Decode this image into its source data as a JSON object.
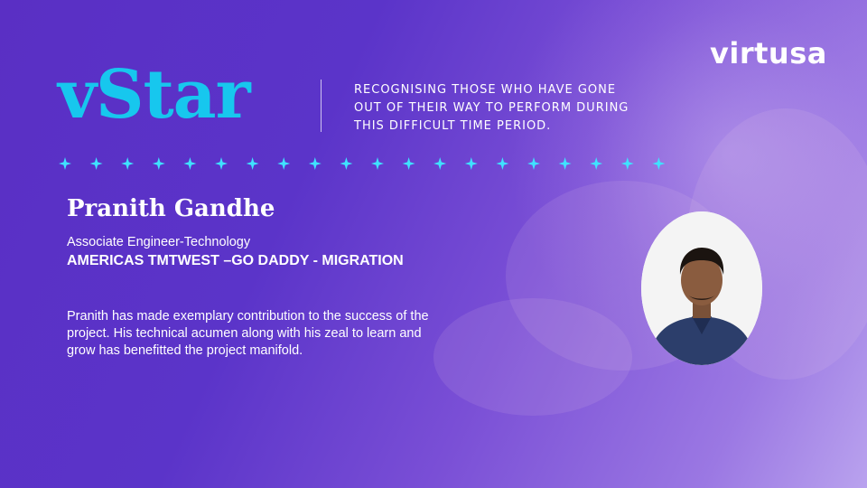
{
  "brand": {
    "logo_text": "virtusa"
  },
  "header": {
    "title": "vStar",
    "tagline_lines": [
      "RECOGNISING THOSE WHO HAVE GONE",
      "OUT OF THEIR WAY TO PERFORM DURING",
      "THIS DIFFICULT TIME PERIOD."
    ]
  },
  "decoration": {
    "sparkle_count": 20,
    "sparkle_icon": "four-point-star-icon"
  },
  "awardee": {
    "name": "Pranith Gandhe",
    "role": "Associate  Engineer-Technology",
    "account": "AMERICAS TMTWEST –GO DADDY - MIGRATION",
    "description_lines": [
      "Pranith has made exemplary contribution to the success of the",
      "project. His technical acumen along with his zeal to learn and",
      "grow has benefitted the project manifold."
    ]
  },
  "colors": {
    "title": "#17c7ee",
    "sparkle": "#3fe2ff",
    "background_start": "#5a2fc4",
    "background_end": "#b9a2ee",
    "text": "#ffffff"
  }
}
